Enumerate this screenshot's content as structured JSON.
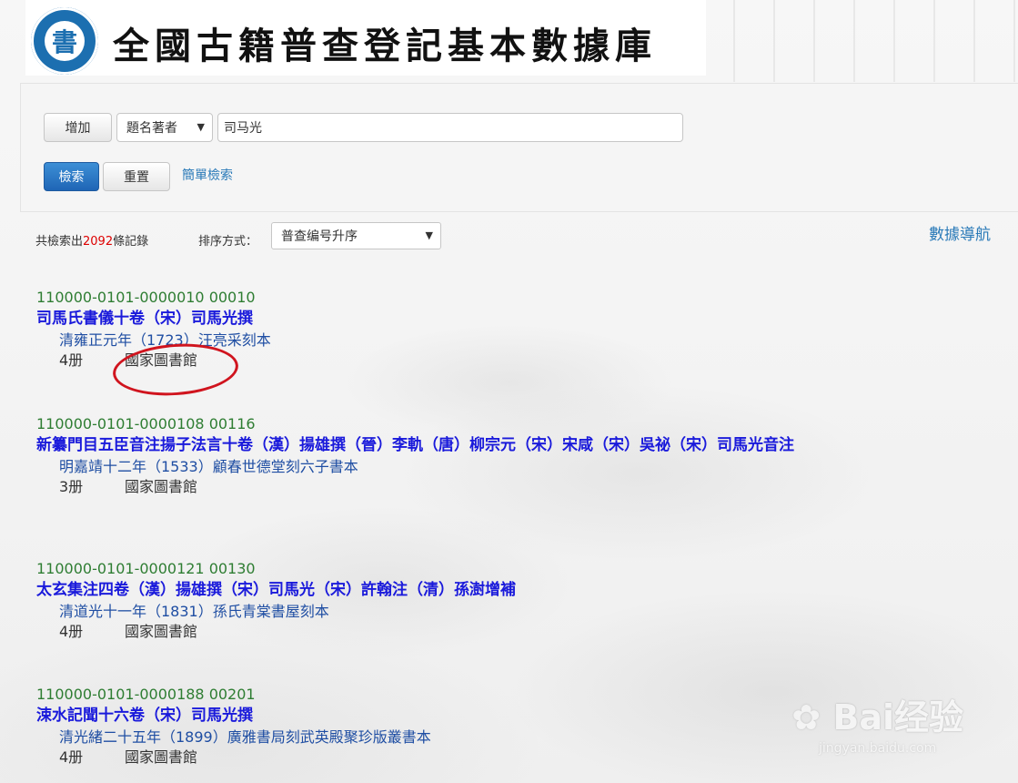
{
  "header": {
    "seal_char": "書",
    "title": "全國古籍普查登記基本數據庫"
  },
  "search": {
    "add_label": "增加",
    "field_select": "題名著者",
    "query_value": "司马光",
    "search_label": "檢索",
    "reset_label": "重置",
    "simple_search_link": "簡單檢索"
  },
  "results_bar": {
    "count_prefix": "共檢索出",
    "count": "2092",
    "count_suffix": "條記錄",
    "sort_label": "排序方式：",
    "sort_value": "普查编号升序",
    "data_nav": "數據導航"
  },
  "records": [
    {
      "id": "110000-0101-0000010 00010",
      "title": "司馬氏書儀十卷（宋）司馬光撰",
      "edition": "清雍正元年（1723）汪亮采刻本",
      "volumes": "4册",
      "holder": "國家圖書館"
    },
    {
      "id": "110000-0101-0000108 00116",
      "title": "新纂門目五臣音注揚子法言十卷（漢）揚雄撰（晉）李軌（唐）柳宗元（宋）宋咸（宋）吳祕（宋）司馬光音注",
      "edition": "明嘉靖十二年（1533）顧春世德堂刻六子書本",
      "volumes": "3册",
      "holder": "國家圖書館"
    },
    {
      "id": "110000-0101-0000121 00130",
      "title": "太玄集注四卷（漢）揚雄撰（宋）司馬光（宋）許翰注（清）孫澍增補",
      "edition": "清道光十一年（1831）孫氏青棠書屋刻本",
      "volumes": "4册",
      "holder": "國家圖書館"
    },
    {
      "id": "110000-0101-0000188 00201",
      "title": "涑水記聞十六卷（宋）司馬光撰",
      "edition": "清光緒二十五年（1899）廣雅書局刻武英殿聚珍版叢書本",
      "volumes": "4册",
      "holder": "國家圖書館"
    }
  ],
  "watermark": {
    "brand": "Bai经验",
    "url": "jingyan.baidu.com"
  },
  "colors": {
    "record_id": "#2e7d32",
    "record_title": "#1a1adb",
    "record_edition": "#1f4ea3",
    "count_highlight": "#dd0000",
    "annotation": "#d0141e",
    "primary_button": "#1f65b5"
  }
}
